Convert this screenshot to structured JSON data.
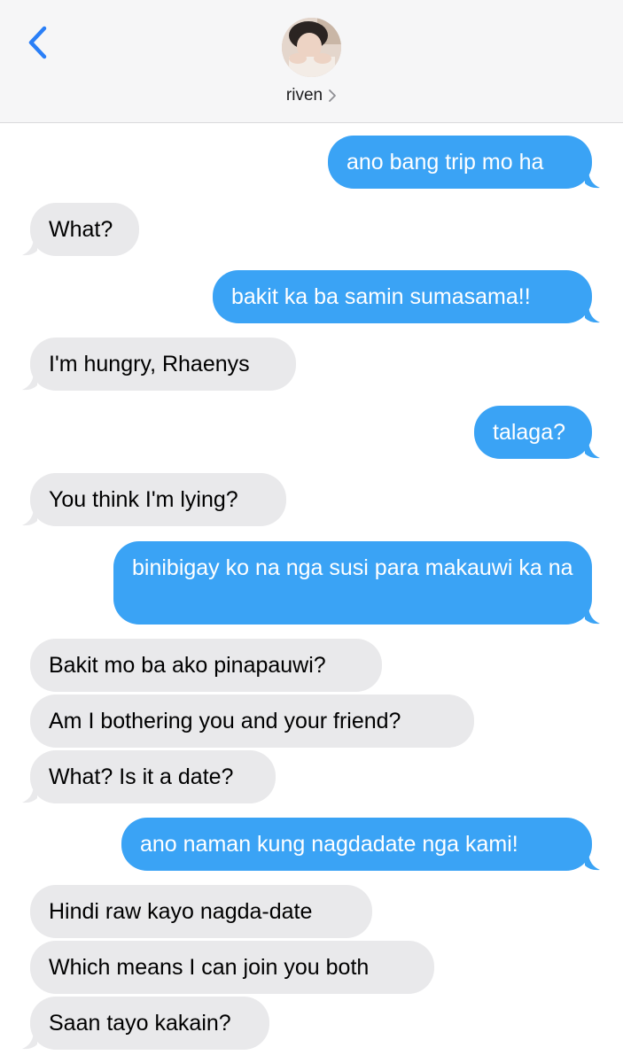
{
  "header": {
    "contact_name": "riven",
    "back_icon": "chevron-left-icon",
    "detail_icon": "chevron-right-icon",
    "accent_color": "#2a7ff7"
  },
  "colors": {
    "outgoing_bubble": "#3aa3f5",
    "incoming_bubble": "#e9e9eb"
  },
  "messages": [
    {
      "direction": "outgoing",
      "text": "ano bang trip mo ha"
    },
    {
      "direction": "incoming",
      "text": "What?"
    },
    {
      "direction": "outgoing",
      "text": "bakit ka ba samin sumasama!!"
    },
    {
      "direction": "incoming",
      "text": "I'm hungry, Rhaenys"
    },
    {
      "direction": "outgoing",
      "text": "talaga?"
    },
    {
      "direction": "incoming",
      "text": "You think I'm lying?"
    },
    {
      "direction": "outgoing",
      "text": "binibigay ko na nga susi para makauwi ka na"
    },
    {
      "direction": "incoming",
      "text": "Bakit mo ba ako pinapauwi?"
    },
    {
      "direction": "incoming",
      "text": "Am I bothering you and your friend?"
    },
    {
      "direction": "incoming",
      "text": "What? Is it a date?"
    },
    {
      "direction": "outgoing",
      "text": "ano naman kung nagdadate nga kami!"
    },
    {
      "direction": "incoming",
      "text": "Hindi raw kayo nagda-date"
    },
    {
      "direction": "incoming",
      "text": "Which means I can join you both"
    },
    {
      "direction": "incoming",
      "text": "Saan tayo kakain?"
    }
  ]
}
